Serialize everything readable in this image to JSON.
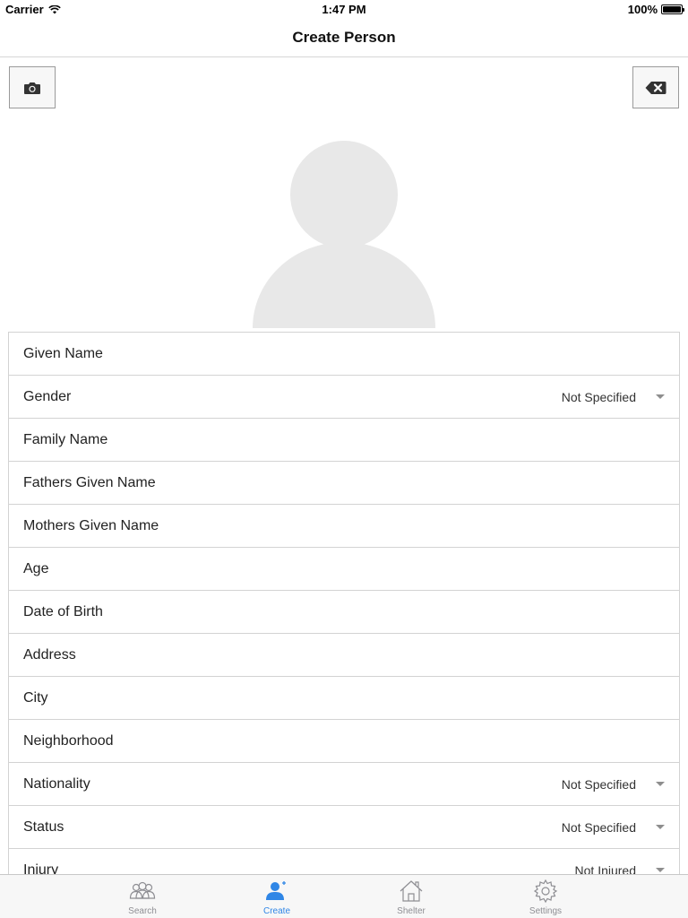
{
  "status_bar": {
    "carrier": "Carrier",
    "time": "1:47 PM",
    "battery": "100%"
  },
  "nav": {
    "title": "Create Person"
  },
  "toolbar": {
    "camera_icon": "camera-icon",
    "delete_icon": "backspace-icon"
  },
  "form": {
    "rows": [
      {
        "label": "Given Name"
      },
      {
        "label": "Gender",
        "value": "Not Specified"
      },
      {
        "label": "Family Name"
      },
      {
        "label": "Fathers Given Name"
      },
      {
        "label": "Mothers Given Name"
      },
      {
        "label": "Age"
      },
      {
        "label": "Date of Birth"
      },
      {
        "label": "Address"
      },
      {
        "label": "City"
      },
      {
        "label": "Neighborhood"
      },
      {
        "label": "Nationality",
        "value": "Not Specified"
      },
      {
        "label": "Status",
        "value": "Not Specified"
      },
      {
        "label": "Injury",
        "value": "Not Injured"
      }
    ]
  },
  "tabs": [
    {
      "label": "Search",
      "icon": "people-icon"
    },
    {
      "label": "Create",
      "icon": "add-person-icon",
      "active": true
    },
    {
      "label": "Shelter",
      "icon": "house-icon"
    },
    {
      "label": "Settings",
      "icon": "gear-icon"
    }
  ],
  "colors": {
    "accent": "#2f86e6",
    "placeholder_gray": "#e8e8e8",
    "border": "#d3d3d3"
  }
}
